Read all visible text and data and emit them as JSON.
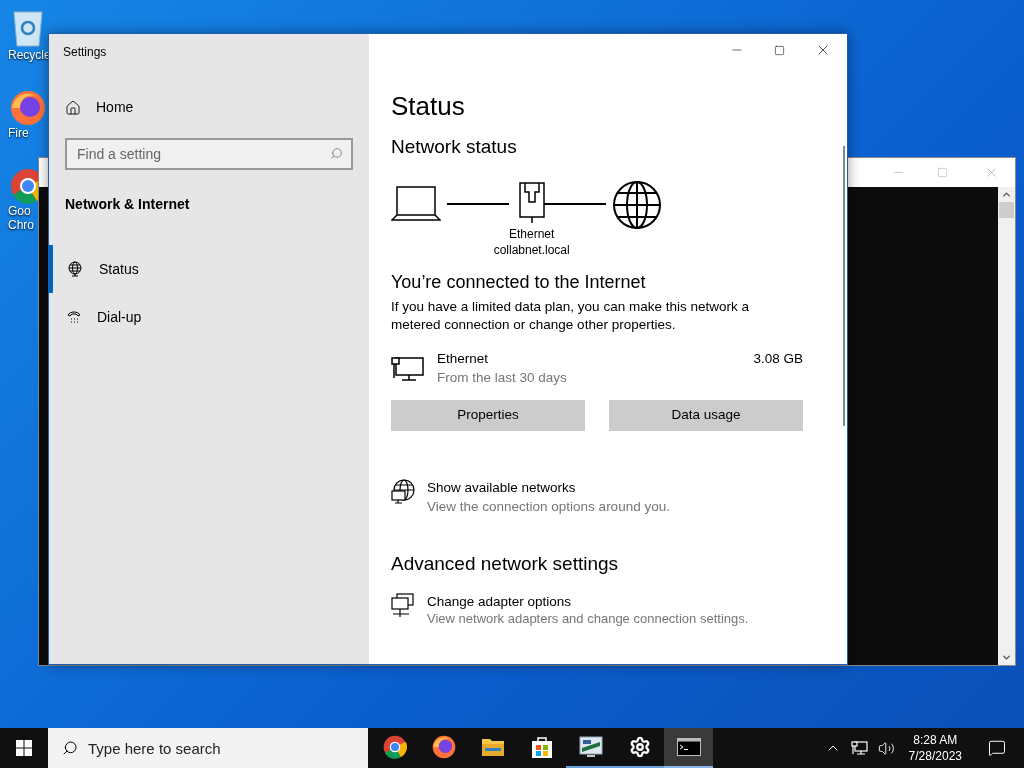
{
  "desktop_icons": [
    {
      "kind": "recycle",
      "label_lines": [
        "Recycle"
      ]
    },
    {
      "kind": "firefox",
      "label_lines": [
        "Fire"
      ]
    },
    {
      "kind": "chrome",
      "label_lines": [
        "Goo",
        "Chro"
      ]
    }
  ],
  "settings": {
    "title": "Settings",
    "home": "Home",
    "search": {
      "placeholder": "Find a setting"
    },
    "section": "Network & Internet",
    "nav": [
      {
        "kind": "globe",
        "label": "Status",
        "selected": true
      },
      {
        "kind": "dialup",
        "label": "Dial-up",
        "selected": false
      }
    ],
    "page_title": "Status",
    "network_status": {
      "heading": "Network status",
      "adapter": "Ethernet",
      "domain": "collabnet.local"
    },
    "connected_heading": "You’re connected to the Internet",
    "connected_text": "If you have a limited data plan, you can make this network a metered connection or change other properties.",
    "connection": {
      "name": "Ethernet",
      "subtitle": "From the last 30 days",
      "usage": "3.08 GB"
    },
    "buttons": [
      "Properties",
      "Data usage"
    ],
    "links": [
      {
        "kind": "globe-monitor",
        "title": "Show available networks",
        "subtitle": "View the connection options around you."
      }
    ],
    "advanced_heading": "Advanced network settings",
    "advanced_links": [
      {
        "kind": "adapters",
        "title": "Change adapter options",
        "subtitle": "View network adapters and change connection settings."
      }
    ]
  },
  "taskbar": {
    "search_placeholder": "Type here to search",
    "apps": [
      {
        "kind": "chrome",
        "running": false,
        "active": false
      },
      {
        "kind": "firefox",
        "running": false,
        "active": false
      },
      {
        "kind": "folder",
        "running": false,
        "active": false
      },
      {
        "kind": "store",
        "running": false,
        "active": false
      },
      {
        "kind": "monitor-app",
        "running": true,
        "active": false
      },
      {
        "kind": "gear",
        "running": true,
        "active": false
      },
      {
        "kind": "terminal",
        "running": true,
        "active": true
      }
    ],
    "time": "8:28 AM",
    "date": "7/28/2023"
  }
}
